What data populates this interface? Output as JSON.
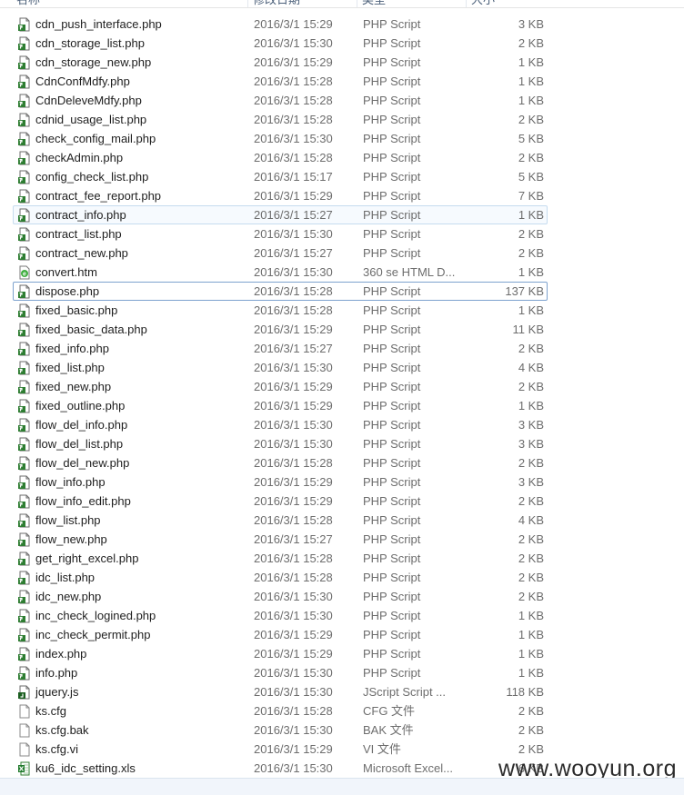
{
  "header": {
    "col_name": "名称",
    "col_date": "修改日期",
    "col_type": "类型",
    "col_size": "大小"
  },
  "files": [
    {
      "name": "cdn_push_interface.php",
      "date": "2016/3/1 15:29",
      "type": "PHP Script",
      "size": "3 KB",
      "icon": "php-file-icon"
    },
    {
      "name": "cdn_storage_list.php",
      "date": "2016/3/1 15:30",
      "type": "PHP Script",
      "size": "2 KB",
      "icon": "php-file-icon"
    },
    {
      "name": "cdn_storage_new.php",
      "date": "2016/3/1 15:29",
      "type": "PHP Script",
      "size": "1 KB",
      "icon": "php-file-icon"
    },
    {
      "name": "CdnConfMdfy.php",
      "date": "2016/3/1 15:28",
      "type": "PHP Script",
      "size": "1 KB",
      "icon": "php-file-icon"
    },
    {
      "name": "CdnDeleveMdfy.php",
      "date": "2016/3/1 15:28",
      "type": "PHP Script",
      "size": "1 KB",
      "icon": "php-file-icon"
    },
    {
      "name": "cdnid_usage_list.php",
      "date": "2016/3/1 15:28",
      "type": "PHP Script",
      "size": "2 KB",
      "icon": "php-file-icon"
    },
    {
      "name": "check_config_mail.php",
      "date": "2016/3/1 15:30",
      "type": "PHP Script",
      "size": "5 KB",
      "icon": "php-file-icon"
    },
    {
      "name": "checkAdmin.php",
      "date": "2016/3/1 15:28",
      "type": "PHP Script",
      "size": "2 KB",
      "icon": "php-file-icon"
    },
    {
      "name": "config_check_list.php",
      "date": "2016/3/1 15:17",
      "type": "PHP Script",
      "size": "5 KB",
      "icon": "php-file-icon"
    },
    {
      "name": "contract_fee_report.php",
      "date": "2016/3/1 15:29",
      "type": "PHP Script",
      "size": "7 KB",
      "icon": "php-file-icon"
    },
    {
      "name": "contract_info.php",
      "date": "2016/3/1 15:27",
      "type": "PHP Script",
      "size": "1 KB",
      "icon": "php-file-icon",
      "state": "hover"
    },
    {
      "name": "contract_list.php",
      "date": "2016/3/1 15:30",
      "type": "PHP Script",
      "size": "2 KB",
      "icon": "php-file-icon"
    },
    {
      "name": "contract_new.php",
      "date": "2016/3/1 15:27",
      "type": "PHP Script",
      "size": "2 KB",
      "icon": "php-file-icon"
    },
    {
      "name": "convert.htm",
      "date": "2016/3/1 15:30",
      "type": "360 se HTML D...",
      "size": "1 KB",
      "icon": "html-file-icon"
    },
    {
      "name": "dispose.php",
      "date": "2016/3/1 15:28",
      "type": "PHP Script",
      "size": "137 KB",
      "icon": "php-file-icon",
      "state": "focus"
    },
    {
      "name": "fixed_basic.php",
      "date": "2016/3/1 15:28",
      "type": "PHP Script",
      "size": "1 KB",
      "icon": "php-file-icon"
    },
    {
      "name": "fixed_basic_data.php",
      "date": "2016/3/1 15:29",
      "type": "PHP Script",
      "size": "11 KB",
      "icon": "php-file-icon"
    },
    {
      "name": "fixed_info.php",
      "date": "2016/3/1 15:27",
      "type": "PHP Script",
      "size": "2 KB",
      "icon": "php-file-icon"
    },
    {
      "name": "fixed_list.php",
      "date": "2016/3/1 15:30",
      "type": "PHP Script",
      "size": "4 KB",
      "icon": "php-file-icon"
    },
    {
      "name": "fixed_new.php",
      "date": "2016/3/1 15:29",
      "type": "PHP Script",
      "size": "2 KB",
      "icon": "php-file-icon"
    },
    {
      "name": "fixed_outline.php",
      "date": "2016/3/1 15:29",
      "type": "PHP Script",
      "size": "1 KB",
      "icon": "php-file-icon"
    },
    {
      "name": "flow_del_info.php",
      "date": "2016/3/1 15:30",
      "type": "PHP Script",
      "size": "3 KB",
      "icon": "php-file-icon"
    },
    {
      "name": "flow_del_list.php",
      "date": "2016/3/1 15:30",
      "type": "PHP Script",
      "size": "3 KB",
      "icon": "php-file-icon"
    },
    {
      "name": "flow_del_new.php",
      "date": "2016/3/1 15:28",
      "type": "PHP Script",
      "size": "2 KB",
      "icon": "php-file-icon"
    },
    {
      "name": "flow_info.php",
      "date": "2016/3/1 15:29",
      "type": "PHP Script",
      "size": "3 KB",
      "icon": "php-file-icon"
    },
    {
      "name": "flow_info_edit.php",
      "date": "2016/3/1 15:29",
      "type": "PHP Script",
      "size": "2 KB",
      "icon": "php-file-icon"
    },
    {
      "name": "flow_list.php",
      "date": "2016/3/1 15:28",
      "type": "PHP Script",
      "size": "4 KB",
      "icon": "php-file-icon"
    },
    {
      "name": "flow_new.php",
      "date": "2016/3/1 15:27",
      "type": "PHP Script",
      "size": "2 KB",
      "icon": "php-file-icon"
    },
    {
      "name": "get_right_excel.php",
      "date": "2016/3/1 15:28",
      "type": "PHP Script",
      "size": "2 KB",
      "icon": "php-file-icon"
    },
    {
      "name": "idc_list.php",
      "date": "2016/3/1 15:28",
      "type": "PHP Script",
      "size": "2 KB",
      "icon": "php-file-icon"
    },
    {
      "name": "idc_new.php",
      "date": "2016/3/1 15:30",
      "type": "PHP Script",
      "size": "2 KB",
      "icon": "php-file-icon"
    },
    {
      "name": "inc_check_logined.php",
      "date": "2016/3/1 15:30",
      "type": "PHP Script",
      "size": "1 KB",
      "icon": "php-file-icon"
    },
    {
      "name": "inc_check_permit.php",
      "date": "2016/3/1 15:29",
      "type": "PHP Script",
      "size": "1 KB",
      "icon": "php-file-icon"
    },
    {
      "name": "index.php",
      "date": "2016/3/1 15:29",
      "type": "PHP Script",
      "size": "1 KB",
      "icon": "php-file-icon"
    },
    {
      "name": "info.php",
      "date": "2016/3/1 15:30",
      "type": "PHP Script",
      "size": "1 KB",
      "icon": "php-file-icon"
    },
    {
      "name": "jquery.js",
      "date": "2016/3/1 15:30",
      "type": "JScript Script ...",
      "size": "118 KB",
      "icon": "js-file-icon"
    },
    {
      "name": "ks.cfg",
      "date": "2016/3/1 15:28",
      "type": "CFG 文件",
      "size": "2 KB",
      "icon": "blank-file-icon"
    },
    {
      "name": "ks.cfg.bak",
      "date": "2016/3/1 15:30",
      "type": "BAK 文件",
      "size": "2 KB",
      "icon": "blank-file-icon"
    },
    {
      "name": "ks.cfg.vi",
      "date": "2016/3/1 15:29",
      "type": "VI 文件",
      "size": "2 KB",
      "icon": "blank-file-icon"
    },
    {
      "name": "ku6_idc_setting.xls",
      "date": "2016/3/1 15:30",
      "type": "Microsoft Excel...",
      "size": "6 KB",
      "icon": "excel-file-icon"
    }
  ],
  "watermark": "www.wooyun.org"
}
